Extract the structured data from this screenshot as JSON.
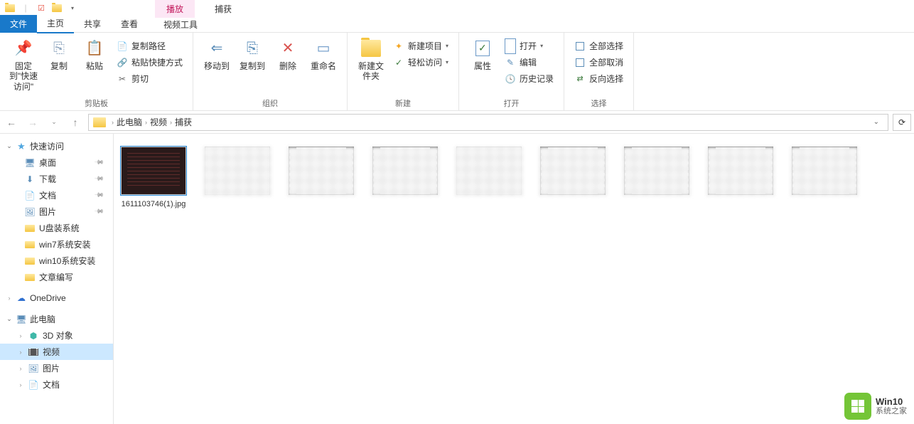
{
  "title_bar": {
    "tab_play": "播放",
    "tab_capture": "捕获"
  },
  "menu_tabs": {
    "file": "文件",
    "home": "主页",
    "share": "共享",
    "view": "查看",
    "video_tools": "视频工具"
  },
  "ribbon": {
    "clipboard": {
      "label": "剪贴板",
      "pin": "固定到\"快速访问\"",
      "copy": "复制",
      "paste": "粘贴",
      "copy_path": "复制路径",
      "paste_shortcut": "粘贴快捷方式",
      "cut": "剪切"
    },
    "organize": {
      "label": "组织",
      "move_to": "移动到",
      "copy_to": "复制到",
      "delete": "删除",
      "rename": "重命名"
    },
    "new": {
      "label": "新建",
      "new_folder": "新建文件夹",
      "new_item": "新建项目",
      "easy_access": "轻松访问"
    },
    "open": {
      "label": "打开",
      "properties": "属性",
      "open": "打开",
      "edit": "编辑",
      "history": "历史记录"
    },
    "select": {
      "label": "选择",
      "select_all": "全部选择",
      "select_none": "全部取消",
      "invert": "反向选择"
    }
  },
  "breadcrumb": {
    "this_pc": "此电脑",
    "videos": "视频",
    "captures": "捕获"
  },
  "sidebar": {
    "quick_access": "快速访问",
    "desktop": "桌面",
    "downloads": "下载",
    "documents": "文档",
    "pictures": "图片",
    "items": [
      "U盘装系统",
      "win7系统安装",
      "win10系统安装",
      "文章编写"
    ],
    "onedrive": "OneDrive",
    "this_pc": "此电脑",
    "objects_3d": "3D 对象",
    "videos": "视频",
    "pictures2": "图片",
    "documents2": "文档"
  },
  "files": {
    "item1": "1611103746(1).jpg"
  },
  "watermark": {
    "line1": "Win10",
    "line2": "系统之家"
  }
}
